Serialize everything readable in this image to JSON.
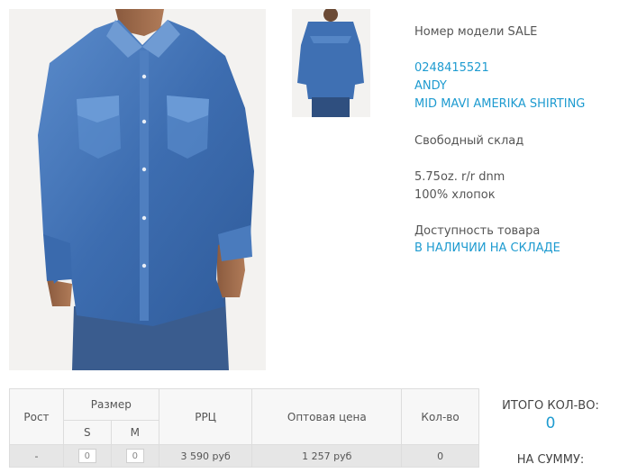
{
  "product": {
    "model_line": "Номер модели SALE",
    "article": "0248415521",
    "brand": "ANDY",
    "name": "MID MAVI AMERIKA SHIRTING",
    "warehouse": "Свободный склад",
    "fabric": "5.75oz. r/r dnm",
    "composition": "100% хлопок",
    "availability_label": "Доступность товара",
    "availability_status": "В НАЛИЧИИ НА СКЛАДЕ"
  },
  "table": {
    "headers": {
      "height": "Рост",
      "size": "Размер",
      "rrp": "РРЦ",
      "wholesale": "Оптовая цена",
      "qty": "Кол-во"
    },
    "sizes": [
      "S",
      "M"
    ],
    "row": {
      "height": "-",
      "size_s_value": "0",
      "size_m_value": "0",
      "rrp": "3 590 руб",
      "wholesale": "1 257 руб",
      "qty": "0"
    }
  },
  "totals": {
    "count_label": "ИТОГО КОЛ-ВО:",
    "count_value": "0",
    "sum_label": "НА СУММУ:"
  },
  "colors": {
    "accent": "#1e9bd0",
    "denim": "#3e6fb0"
  }
}
